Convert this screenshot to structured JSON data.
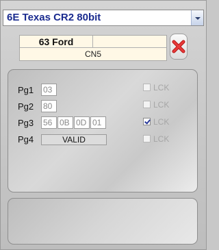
{
  "dropdown": {
    "selected": "6E Texas CR2 80bit"
  },
  "info": {
    "top_left": "63 Ford",
    "top_right": "",
    "bottom": "CN5"
  },
  "pages": [
    {
      "label": "Pg1",
      "bytes": [
        "03"
      ],
      "lck_label": "LCK",
      "locked": false
    },
    {
      "label": "Pg2",
      "bytes": [
        "80"
      ],
      "lck_label": "LCK",
      "locked": false
    },
    {
      "label": "Pg3",
      "bytes": [
        "56",
        "0B",
        "0D",
        "01"
      ],
      "lck_label": "LCK",
      "locked": true
    },
    {
      "label": "Pg4",
      "status": "VALID",
      "lck_label": "LCK",
      "locked": false
    }
  ],
  "colors": {
    "title_blue": "#1a2b8f",
    "delete_red": "#d42020"
  },
  "icons": {
    "delete": "red-x-icon",
    "dropdown": "chevron-down-icon"
  }
}
